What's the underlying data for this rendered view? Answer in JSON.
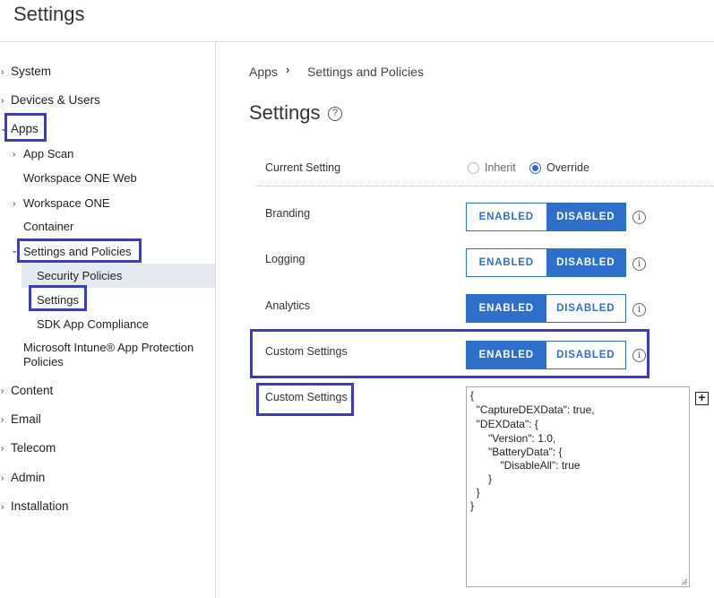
{
  "header": {
    "title": "Settings"
  },
  "sidebar": {
    "items": [
      {
        "label": "System"
      },
      {
        "label": "Devices & Users"
      },
      {
        "label": "Apps"
      },
      {
        "label": "App Scan"
      },
      {
        "label": "Workspace ONE Web"
      },
      {
        "label": "Workspace ONE"
      },
      {
        "label": "Container"
      },
      {
        "label": "Settings and Policies"
      },
      {
        "label": "Security Policies"
      },
      {
        "label": "Settings"
      },
      {
        "label": "SDK App Compliance"
      },
      {
        "label": "Microsoft Intune® App Protection"
      },
      {
        "label": "Policies"
      },
      {
        "label": "Content"
      },
      {
        "label": "Email"
      },
      {
        "label": "Telecom"
      },
      {
        "label": "Admin"
      },
      {
        "label": "Installation"
      }
    ]
  },
  "breadcrumb": {
    "root": "Apps",
    "current": "Settings and Policies"
  },
  "main": {
    "title": "Settings",
    "current_setting": {
      "label": "Current Setting",
      "options": [
        "Inherit",
        "Override"
      ],
      "selected": "Override"
    },
    "rows": [
      {
        "label": "Branding",
        "enabled": "ENABLED",
        "disabled": "DISABLED",
        "state": "disabled"
      },
      {
        "label": "Logging",
        "enabled": "ENABLED",
        "disabled": "DISABLED",
        "state": "disabled"
      },
      {
        "label": "Analytics",
        "enabled": "ENABLED",
        "disabled": "DISABLED",
        "state": "enabled"
      },
      {
        "label": "Custom Settings",
        "enabled": "ENABLED",
        "disabled": "DISABLED",
        "state": "enabled"
      }
    ],
    "custom_settings": {
      "label": "Custom Settings",
      "lines": [
        "{",
        "  \"CaptureDEXData\": true,",
        "  \"DEXData\": {",
        "      \"Version\": 1.0,",
        "      \"BatteryData\": {",
        "          \"DisableAll\": true",
        "      }",
        "  }",
        "}"
      ]
    }
  },
  "icons": {
    "help": "?",
    "info": "i",
    "add": "+"
  },
  "colors": {
    "accent": "#2f6fcc",
    "highlight": "#3b3bc5"
  }
}
